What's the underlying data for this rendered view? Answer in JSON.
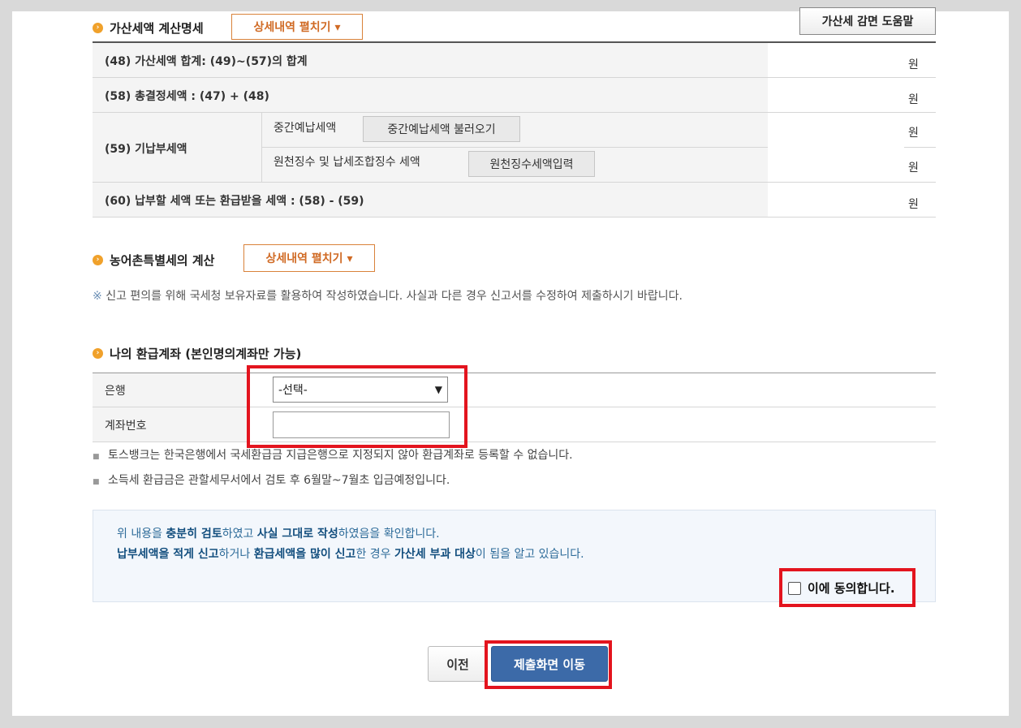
{
  "penalty": {
    "title": "가산세액 계산명세",
    "expand_label": "상세내역 펼치기 ▾",
    "help_label": "가산세 감면 도움말",
    "rows": [
      {
        "label": "(48) 가산세액 합계: (49)~(57)의 합계",
        "unit": "원"
      },
      {
        "label": "(58) 총결정세액 : (47) + (48)",
        "unit": "원"
      },
      {
        "label": "(59) 기납부세액",
        "unit": "원"
      },
      {
        "label": "(60) 납부할 세액 또는 환급받을 세액 : (58) - (59)",
        "unit": "원"
      }
    ],
    "sub1_label": "중간예납세액",
    "sub1_button": "중간예납세액 불러오기",
    "sub1_unit": "원",
    "sub2_label": "원천징수 및 납세조합징수 세액",
    "sub2_button": "원천징수세액입력",
    "sub2_unit": "원"
  },
  "rural": {
    "title": "농어촌특별세의 계산",
    "expand_label": "상세내역 펼치기 ▾"
  },
  "notice": {
    "mark": "※",
    "text": "신고 편의를 위해 국세청 보유자료를 활용하여 작성하였습니다. 사실과 다른 경우 신고서를 수정하여 제출하시기 바랍니다."
  },
  "refund": {
    "title": "나의 환급계좌 (본인명의계좌만 가능)",
    "bank_label": "은행",
    "bank_value": "-선택-",
    "account_label": "계좌번호",
    "account_value": "",
    "note1": "토스뱅크는 한국은행에서 국세환급금 지급은행으로 지정되지 않아 환급계좌로 등록할 수 없습니다.",
    "note2": "소득세 환급금은 관할세무서에서 검토 후 6월말~7월초 입금예정입니다."
  },
  "confirm": {
    "l1_a": "위 내용을 ",
    "l1_b": "충분히 검토",
    "l1_c": "하였고 ",
    "l1_d": "사실 그대로 작성",
    "l1_e": "하였음을 확인합니다.",
    "l2_a": "납부세액을 적게 신고",
    "l2_b": "하거나 ",
    "l2_c": "환급세액을 많이 신고",
    "l2_d": "한 경우 ",
    "l2_e": "가산세 부과 대상",
    "l2_f": "이 됨을 알고 있습니다.",
    "agree_label": "이에 동의합니다."
  },
  "buttons": {
    "prev": "이전",
    "submit": "제출화면 이동"
  },
  "colors": {
    "highlight": "#e3141e",
    "primary_button": "#3c6aa8",
    "accent": "#d06a24"
  }
}
